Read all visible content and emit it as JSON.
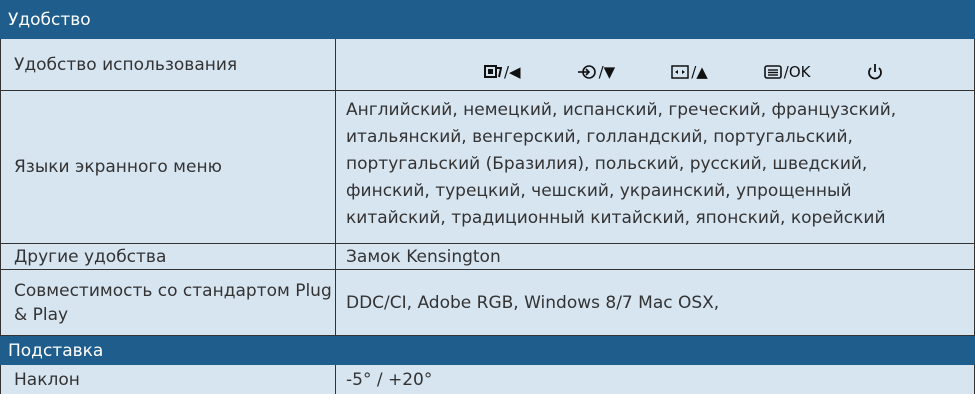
{
  "sections": {
    "convenience": "Удобство",
    "stand": "Подставка"
  },
  "rows": {
    "ease_of_use": {
      "label": "Удобство использования"
    },
    "osd_languages": {
      "label": "Языки экранного меню",
      "value": "Английский, немецкий, испанский, греческий, французский, итальянский, венгерский, голландский, португальский, португальский (Бразилия), польский, русский, шведский, финский, турецкий, чешский, украинский, упрощенный китайский, традиционный китайский, японский, корейский"
    },
    "other": {
      "label": "Другие удобства",
      "value": "Замок Kensington"
    },
    "plug_play": {
      "label": "Совместимость со стандартом Plug & Play",
      "value": "DDC/CI, Adobe RGB, Windows 8/7 Mac OSX,"
    },
    "tilt": {
      "label": "Наклон",
      "value": "-5° / +20°"
    }
  },
  "buttons": [
    {
      "icon": "smartimage-icon",
      "label": "/◀"
    },
    {
      "icon": "input-icon",
      "label": "/▼"
    },
    {
      "icon": "format-icon",
      "label": "/▲"
    },
    {
      "icon": "menu-icon",
      "label": "/OK"
    },
    {
      "icon": "power-icon",
      "label": ""
    }
  ],
  "colors": {
    "section_bg": "#1f5e8c",
    "cell_bg": "#d7e5f1",
    "text": "#333333"
  }
}
